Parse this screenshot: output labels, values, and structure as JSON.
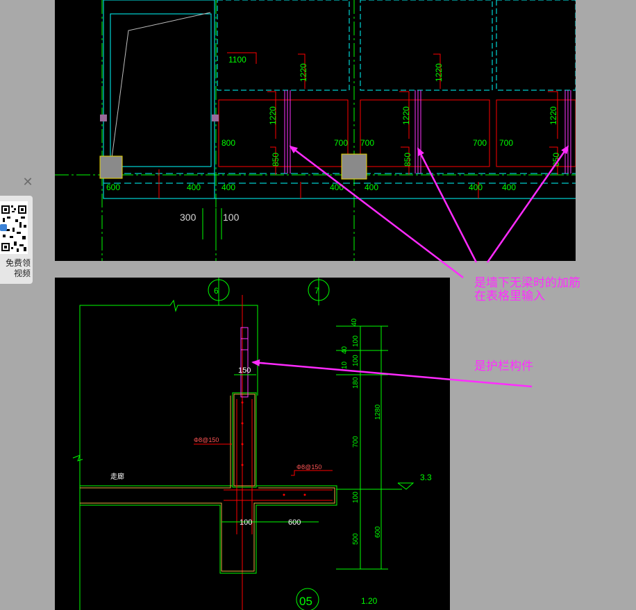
{
  "side_panel": {
    "close_icon": "✕",
    "qr_line1": "免费领",
    "qr_line2": "视频"
  },
  "plan_drawing": {
    "labels": {
      "d1100": "1100",
      "d1220a": "1220",
      "d1220b": "1220",
      "d1220c": "1220",
      "d1220d": "1220",
      "d1220e": "1220",
      "d800": "800",
      "d700a": "700",
      "d700b": "700",
      "d700c": "700",
      "d700d": "700",
      "d850a": "850",
      "d850b": "850",
      "d850c": "850",
      "d600": "600",
      "d400a": "400",
      "d400b": "400",
      "d400c": "400",
      "d400d": "400",
      "d400e": "400",
      "d400f": "400",
      "d300": "300",
      "d100": "100"
    }
  },
  "section_drawing": {
    "axis6": "6",
    "axis7": "7",
    "detail_no": "05",
    "scale": "1.20",
    "d150": "150",
    "rebar1": "Φ8@150",
    "rebar2": "Φ8@150",
    "corridor": "走廊",
    "level": "3.3",
    "dim_100": "100",
    "dim_600": "600",
    "v40a": "40",
    "v40b": "40",
    "v100a": "100",
    "v100b": "100",
    "v10": "10",
    "v180": "180",
    "v1280": "1280",
    "v700": "700",
    "v100c": "100",
    "v500": "500",
    "v600": "600"
  },
  "annotations": {
    "note1_line1": "是墙下无梁时的加筋",
    "note1_line2": "在表格里输入",
    "note2": "是护栏构件"
  },
  "colors": {
    "annotation": "#ff2bff",
    "dim_text": "#00ff00",
    "red_line": "#ff0000",
    "cyan_line": "#00ffff"
  }
}
